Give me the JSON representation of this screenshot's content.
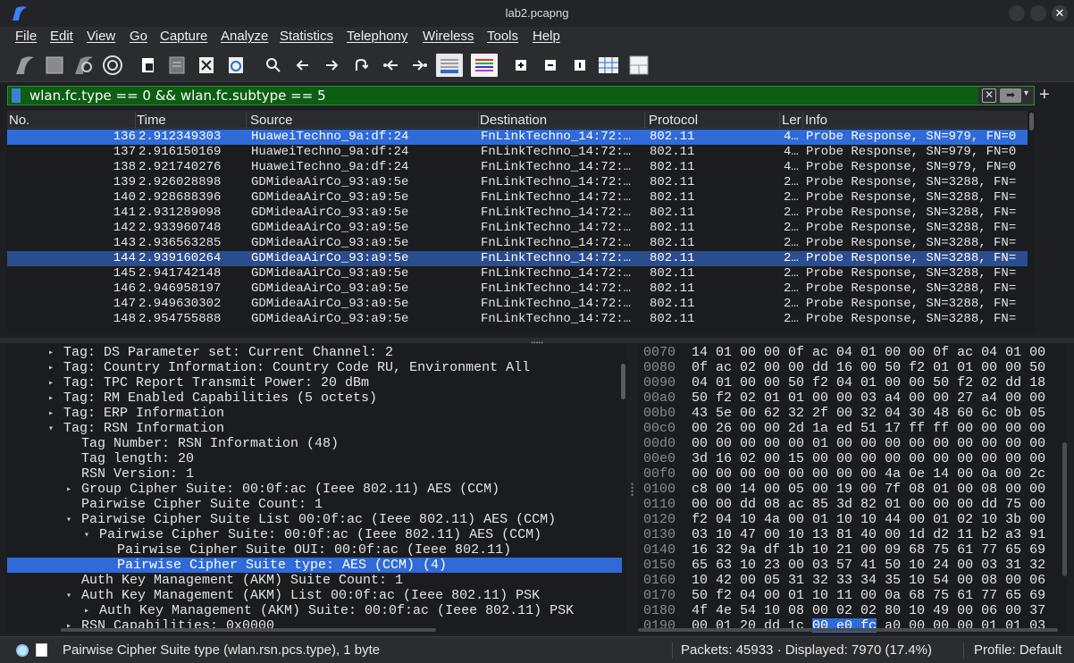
{
  "window": {
    "title": "lab2.pcapng"
  },
  "menu": [
    "File",
    "Edit",
    "View",
    "Go",
    "Capture",
    "Analyze",
    "Statistics",
    "Telephony",
    "Wireless",
    "Tools",
    "Help"
  ],
  "toolbar_icons": [
    "start-capture-icon",
    "stop-capture-icon",
    "restart-capture-icon",
    "capture-options-icon",
    "open-file-icon",
    "save-file-icon",
    "close-file-icon",
    "reload-file-icon",
    "find-packet-icon",
    "go-back-icon",
    "go-forward-icon",
    "go-to-packet-icon",
    "go-first-icon",
    "go-last-icon",
    "autoscroll-icon",
    "colorize-icon",
    "zoom-in-icon",
    "zoom-out-icon",
    "normal-size-icon",
    "resize-columns-icon",
    "column-prefs-icon"
  ],
  "filter": {
    "value": "wlan.fc.type == 0 && wlan.fc.subtype == 5"
  },
  "packet_list": {
    "columns": [
      "No.",
      "Time",
      "Source",
      "Destination",
      "Protocol",
      "Ler",
      "Info"
    ],
    "rows": [
      {
        "no": "136",
        "time": "2.912349303",
        "src": "HuaweiTechno_9a:df:24",
        "dst": "FnLinkTechno_14:72:…",
        "proto": "802.11",
        "len": "4…",
        "info": "Probe Response, SN=979, FN=0"
      },
      {
        "no": "137",
        "time": "2.916150169",
        "src": "HuaweiTechno_9a:df:24",
        "dst": "FnLinkTechno_14:72:…",
        "proto": "802.11",
        "len": "4…",
        "info": "Probe Response, SN=979, FN=0"
      },
      {
        "no": "138",
        "time": "2.921740276",
        "src": "HuaweiTechno_9a:df:24",
        "dst": "FnLinkTechno_14:72:…",
        "proto": "802.11",
        "len": "4…",
        "info": "Probe Response, SN=979, FN=0"
      },
      {
        "no": "139",
        "time": "2.926028898",
        "src": "GDMideaAirCo_93:a9:5e",
        "dst": "FnLinkTechno_14:72:…",
        "proto": "802.11",
        "len": "2…",
        "info": "Probe Response, SN=3288, FN="
      },
      {
        "no": "140",
        "time": "2.928688396",
        "src": "GDMideaAirCo_93:a9:5e",
        "dst": "FnLinkTechno_14:72:…",
        "proto": "802.11",
        "len": "2…",
        "info": "Probe Response, SN=3288, FN="
      },
      {
        "no": "141",
        "time": "2.931289098",
        "src": "GDMideaAirCo_93:a9:5e",
        "dst": "FnLinkTechno_14:72:…",
        "proto": "802.11",
        "len": "2…",
        "info": "Probe Response, SN=3288, FN="
      },
      {
        "no": "142",
        "time": "2.933960748",
        "src": "GDMideaAirCo_93:a9:5e",
        "dst": "FnLinkTechno_14:72:…",
        "proto": "802.11",
        "len": "2…",
        "info": "Probe Response, SN=3288, FN="
      },
      {
        "no": "143",
        "time": "2.936563285",
        "src": "GDMideaAirCo_93:a9:5e",
        "dst": "FnLinkTechno_14:72:…",
        "proto": "802.11",
        "len": "2…",
        "info": "Probe Response, SN=3288, FN="
      },
      {
        "no": "144",
        "time": "2.939160264",
        "src": "GDMideaAirCo_93:a9:5e",
        "dst": "FnLinkTechno_14:72:…",
        "proto": "802.11",
        "len": "2…",
        "info": "Probe Response, SN=3288, FN="
      },
      {
        "no": "145",
        "time": "2.941742148",
        "src": "GDMideaAirCo_93:a9:5e",
        "dst": "FnLinkTechno_14:72:…",
        "proto": "802.11",
        "len": "2…",
        "info": "Probe Response, SN=3288, FN="
      },
      {
        "no": "146",
        "time": "2.946958197",
        "src": "GDMideaAirCo_93:a9:5e",
        "dst": "FnLinkTechno_14:72:…",
        "proto": "802.11",
        "len": "2…",
        "info": "Probe Response, SN=3288, FN="
      },
      {
        "no": "147",
        "time": "2.949630302",
        "src": "GDMideaAirCo_93:a9:5e",
        "dst": "FnLinkTechno_14:72:…",
        "proto": "802.11",
        "len": "2…",
        "info": "Probe Response, SN=3288, FN="
      },
      {
        "no": "148",
        "time": "2.954755888",
        "src": "GDMideaAirCo_93:a9:5e",
        "dst": "FnLinkTechno_14:72:…",
        "proto": "802.11",
        "len": "2…",
        "info": "Probe Response, SN=3288, FN="
      }
    ]
  },
  "details": [
    {
      "text": "Tag: DS Parameter set: Current Channel: 2",
      "arrow": "▸"
    },
    {
      "text": "Tag: Country Information: Country Code RU, Environment All",
      "arrow": "▸"
    },
    {
      "text": "Tag: TPC Report Transmit Power: 20 dBm",
      "arrow": "▸"
    },
    {
      "text": "Tag: RM Enabled Capabilities (5 octets)",
      "arrow": "▸"
    },
    {
      "text": "Tag: ERP Information",
      "arrow": "▸"
    },
    {
      "text": "Tag: RSN Information",
      "arrow": "▾"
    },
    {
      "text": "Tag Number: RSN Information (48)",
      "arrow": ""
    },
    {
      "text": "Tag length: 20",
      "arrow": ""
    },
    {
      "text": "RSN Version: 1",
      "arrow": ""
    },
    {
      "text": "Group Cipher Suite: 00:0f:ac (Ieee 802.11) AES (CCM)",
      "arrow": "▸"
    },
    {
      "text": "Pairwise Cipher Suite Count: 1",
      "arrow": ""
    },
    {
      "text": "Pairwise Cipher Suite List 00:0f:ac (Ieee 802.11) AES (CCM)",
      "arrow": "▾"
    },
    {
      "text": "Pairwise Cipher Suite: 00:0f:ac (Ieee 802.11) AES (CCM)",
      "arrow": "▾"
    },
    {
      "text": "Pairwise Cipher Suite OUI: 00:0f:ac (Ieee 802.11)",
      "arrow": ""
    },
    {
      "text": "Pairwise Cipher Suite type: AES (CCM) (4)",
      "arrow": ""
    },
    {
      "text": "Auth Key Management (AKM) Suite Count: 1",
      "arrow": ""
    },
    {
      "text": "Auth Key Management (AKM) List 00:0f:ac (Ieee 802.11) PSK",
      "arrow": "▾"
    },
    {
      "text": "Auth Key Management (AKM) Suite: 00:0f:ac (Ieee 802.11) PSK",
      "arrow": "▸"
    },
    {
      "text": "RSN Capabilities: 0x0000",
      "arrow": "▸"
    }
  ],
  "hex": [
    {
      "off": "0070",
      "a": "14 01 00 00 0f ac 04 01",
      "b": "00 00 0f ac 04 01 00"
    },
    {
      "off": "0080",
      "a": "0f ac 02 00 00 dd 16 00",
      "b": "50 f2 01 01 00 00 50"
    },
    {
      "off": "0090",
      "a": "04 01 00 00 50 f2 04 01",
      "b": "00 00 50 f2 02 dd 18"
    },
    {
      "off": "00a0",
      "a": "50 f2 02 01 01 00 00 03",
      "b": "a4 00 00 27 a4 00 00"
    },
    {
      "off": "00b0",
      "a": "43 5e 00 62 32 2f 00 32",
      "b": "04 30 48 60 6c 0b 05"
    },
    {
      "off": "00c0",
      "a": "00 26 00 00 2d 1a ed 51",
      "b": "17 ff ff 00 00 00 00"
    },
    {
      "off": "00d0",
      "a": "00 00 00 00 00 01 00 00",
      "b": "00 00 00 00 00 00 00"
    },
    {
      "off": "00e0",
      "a": "3d 16 02 00 15 00 00 00",
      "b": "00 00 00 00 00 00 00"
    },
    {
      "off": "00f0",
      "a": "00 00 00 00 00 00 00 00",
      "b": "4a 0e 14 00 0a 00 2c"
    },
    {
      "off": "0100",
      "a": "c8 00 14 00 05 00 19 00",
      "b": "7f 08 01 00 08 00 00"
    },
    {
      "off": "0110",
      "a": "00 00 dd 08 ac 85 3d 82",
      "b": "01 00 00 00 dd 75 00"
    },
    {
      "off": "0120",
      "a": "f2 04 10 4a 00 01 10 10",
      "b": "44 00 01 02 10 3b 00"
    },
    {
      "off": "0130",
      "a": "03 10 47 00 10 13 81 40",
      "b": "00 1d d2 11 b2 a3 91"
    },
    {
      "off": "0140",
      "a": "16 32 9a df 1b 10 21 00",
      "b": "09 68 75 61 77 65 69"
    },
    {
      "off": "0150",
      "a": "65 63 10 23 00 03 57 41",
      "b": "50 10 24 00 03 31 32"
    },
    {
      "off": "0160",
      "a": "10 42 00 05 31 32 33 34",
      "b": "35 10 54 00 08 00 06"
    },
    {
      "off": "0170",
      "a": "50 f2 04 00 01 10 11 00",
      "b": "0a 68 75 61 77 65 69"
    },
    {
      "off": "0180",
      "a": "4f 4e 54 10 08 00 02 02",
      "b": "80 10 49 00 06 00 37"
    },
    {
      "off": "0190",
      "a": "00 01 20 dd 1c",
      "hl": "00 e0 fc",
      "b": "a0 00 00 00 01 01 03"
    }
  ],
  "status": {
    "field": "Pairwise Cipher Suite type (wlan.rsn.pcs.type), 1 byte",
    "packets": "Packets: 45933 · Displayed: 7970 (17.4%)",
    "profile": "Profile: Default"
  },
  "colors": {
    "selected": "#2f6ad8",
    "filter_ok": "#0b5e12"
  }
}
